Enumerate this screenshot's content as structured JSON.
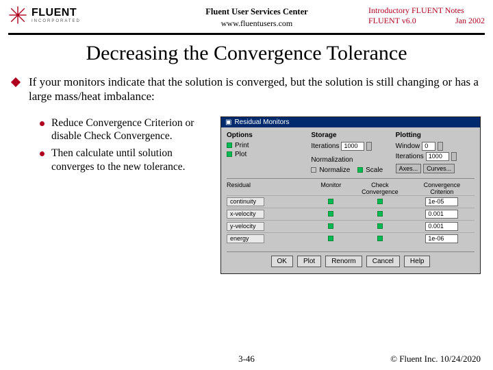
{
  "header": {
    "logo_word": "FLUENT",
    "logo_sub": "INCORPORATED",
    "center1": "Fluent User Services Center",
    "center2": "www.fluentusers.com",
    "right1": "Introductory FLUENT Notes",
    "right2a": "FLUENT v6.0",
    "right2b": "Jan 2002"
  },
  "title": "Decreasing the Convergence Tolerance",
  "intro": "If your monitors indicate that the solution is converged, but the solution is still changing or has a large mass/heat imbalance:",
  "bullets": [
    "Reduce Convergence Criterion or disable Check Convergence.",
    "Then calculate until solution converges to the new tolerance."
  ],
  "dialog": {
    "title": "Residual Monitors",
    "groups": {
      "options": "Options",
      "storage": "Storage",
      "plotting": "Plotting"
    },
    "opts": {
      "print": "Print",
      "plot": "Plot"
    },
    "storage": {
      "iter_label": "Iterations",
      "iter_val": "1000"
    },
    "plotting": {
      "window_label": "Window",
      "window_val": "0",
      "iter_label": "Iterations",
      "iter_val": "1000"
    },
    "norm": {
      "normalize": "Normalize",
      "scale": "Scale",
      "axes": "Axes...",
      "curves": "Curves..."
    },
    "cols": {
      "res": "Residual",
      "mon": "Monitor",
      "chk1": "Check",
      "chk2": "Convergence",
      "crit1": "Convergence",
      "crit2": "Criterion"
    },
    "rows": [
      {
        "name": "continuity",
        "crit": "1e-05"
      },
      {
        "name": "x-velocity",
        "crit": "0.001"
      },
      {
        "name": "y-velocity",
        "crit": "0.001"
      },
      {
        "name": "energy",
        "crit": "1e-06"
      }
    ],
    "buttons": {
      "ok": "OK",
      "plot": "Plot",
      "renorm": "Renorm",
      "cancel": "Cancel",
      "help": "Help"
    }
  },
  "footer": {
    "page": "3-46",
    "copy": "© Fluent Inc. 10/24/2020"
  }
}
